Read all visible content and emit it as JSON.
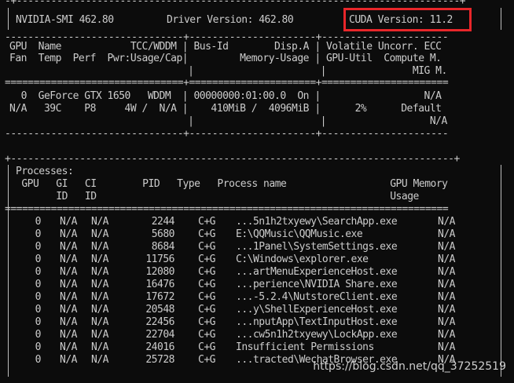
{
  "header": {
    "smi_label": "NVIDIA-SMI 462.80",
    "driver_label": "Driver Version: 462.80",
    "cuda_label": "CUDA Version: 11.2"
  },
  "highlight_color": "#e8262a",
  "gpu_table": {
    "head_row1": "GPU  Name            TCC/WDDM | Bus-Id        Disp.A | Volatile Uncorr. ECC",
    "head_row2": "Fan  Temp  Perf  Pwr:Usage/Cap|         Memory-Usage | GPU-Util  Compute M.",
    "head_row3": "                               |                      |               MIG M.",
    "sep_double": "===============================+======================+======================",
    "row1": "  0  GeForce GTX 1650   WDDM  | 00000000:01:00.0  On |                  N/A",
    "row2": "N/A   39C    P8     4W /  N/A |    410MiB /  4096MiB |      2%      Default",
    "row3": "                               |                      |                  N/A",
    "sep_dash": "-------------------------------+----------------------+----------------------"
  },
  "processes": {
    "title": "Processes:",
    "head1": " GPU   GI   CI        PID   Type   Process name                  GPU Memory",
    "head2": "       ID   ID                                                   Usage",
    "sep": "=============================================================================",
    "rows": [
      {
        "gpu": "0",
        "gi": "N/A",
        "ci": "N/A",
        "pid": "2244",
        "type": "C+G",
        "name": "...5n1h2txyewy\\SearchApp.exe",
        "mem": "N/A"
      },
      {
        "gpu": "0",
        "gi": "N/A",
        "ci": "N/A",
        "pid": "5680",
        "type": "C+G",
        "name": "E:\\QQMusic\\QQMusic.exe",
        "mem": "N/A"
      },
      {
        "gpu": "0",
        "gi": "N/A",
        "ci": "N/A",
        "pid": "8684",
        "type": "C+G",
        "name": "...1Panel\\SystemSettings.exe",
        "mem": "N/A"
      },
      {
        "gpu": "0",
        "gi": "N/A",
        "ci": "N/A",
        "pid": "11756",
        "type": "C+G",
        "name": "C:\\Windows\\explorer.exe",
        "mem": "N/A"
      },
      {
        "gpu": "0",
        "gi": "N/A",
        "ci": "N/A",
        "pid": "12080",
        "type": "C+G",
        "name": "...artMenuExperienceHost.exe",
        "mem": "N/A"
      },
      {
        "gpu": "0",
        "gi": "N/A",
        "ci": "N/A",
        "pid": "16476",
        "type": "C+G",
        "name": "...perience\\NVIDIA Share.exe",
        "mem": "N/A"
      },
      {
        "gpu": "0",
        "gi": "N/A",
        "ci": "N/A",
        "pid": "17672",
        "type": "C+G",
        "name": "...-5.2.4\\NutstoreClient.exe",
        "mem": "N/A"
      },
      {
        "gpu": "0",
        "gi": "N/A",
        "ci": "N/A",
        "pid": "20548",
        "type": "C+G",
        "name": "...y\\ShellExperienceHost.exe",
        "mem": "N/A"
      },
      {
        "gpu": "0",
        "gi": "N/A",
        "ci": "N/A",
        "pid": "22456",
        "type": "C+G",
        "name": "...nputApp\\TextInputHost.exe",
        "mem": "N/A"
      },
      {
        "gpu": "0",
        "gi": "N/A",
        "ci": "N/A",
        "pid": "22704",
        "type": "C+G",
        "name": "...cw5n1h2txyewy\\LockApp.exe",
        "mem": "N/A"
      },
      {
        "gpu": "0",
        "gi": "N/A",
        "ci": "N/A",
        "pid": "24016",
        "type": "C+G",
        "name": "Insufficient Permissions",
        "mem": "N/A"
      },
      {
        "gpu": "0",
        "gi": "N/A",
        "ci": "N/A",
        "pid": "25728",
        "type": "C+G",
        "name": "...tracted\\WechatBrowser.exe",
        "mem": "N/A"
      }
    ]
  },
  "watermark": "https://blog.csdn.net/qq_37252519"
}
